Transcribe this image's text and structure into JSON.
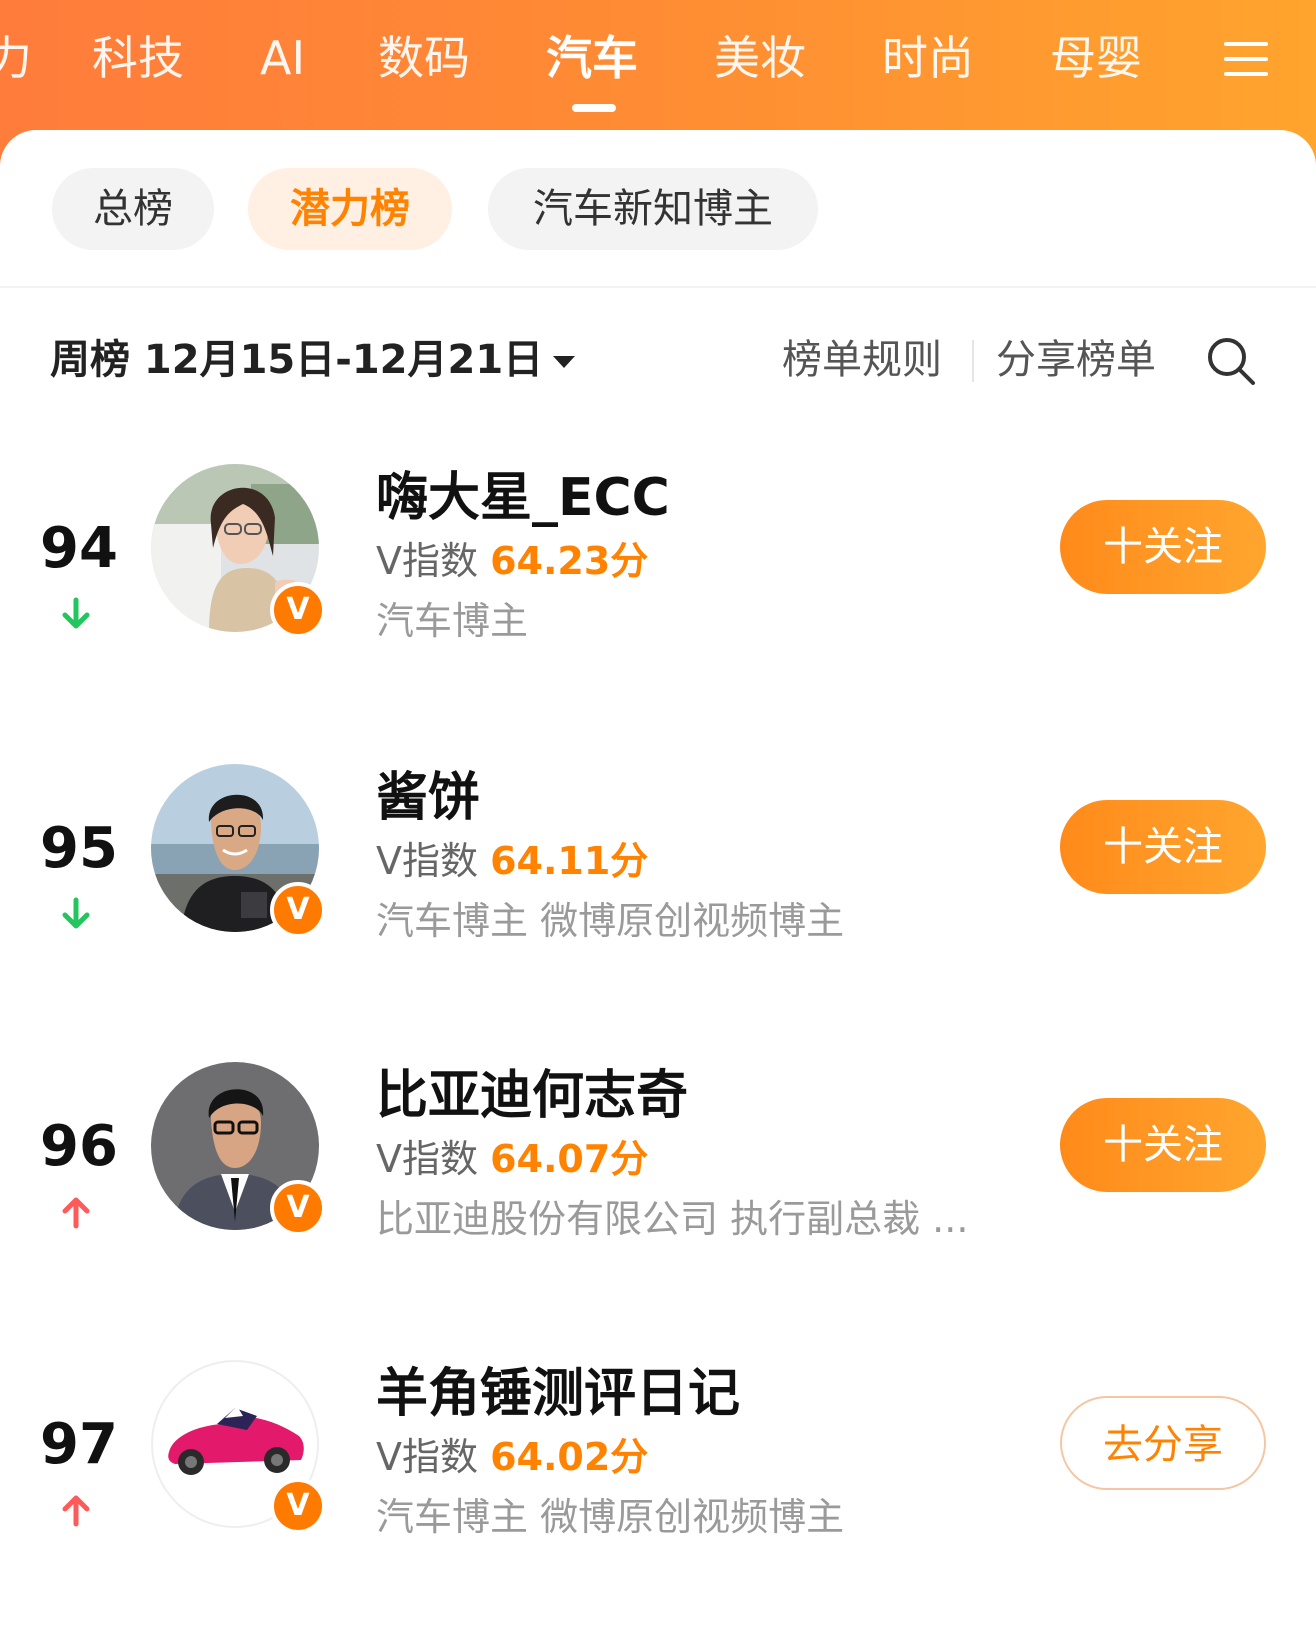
{
  "categories": {
    "items": [
      "力",
      "科技",
      "AI",
      "数码",
      "汽车",
      "美妆",
      "时尚",
      "母婴"
    ],
    "active": "汽车"
  },
  "chips": [
    "总榜",
    "潜力榜",
    "汽车新知博主"
  ],
  "period": "周榜 12月15日-12月21日",
  "links": {
    "rules": "榜单规则",
    "share": "分享榜单"
  },
  "v_label": "V指数",
  "v_badge": "V",
  "rows": [
    {
      "rank": "94",
      "trend": "down",
      "name": "嗨大星_ECC",
      "score": "64.23分",
      "tags": "汽车博主",
      "button": "十关注"
    },
    {
      "rank": "95",
      "trend": "down",
      "name": "酱饼",
      "score": "64.11分",
      "tags": "汽车博主 微博原创视频博主",
      "button": "十关注"
    },
    {
      "rank": "96",
      "trend": "up",
      "name": "比亚迪何志奇",
      "score": "64.07分",
      "tags": "比亚迪股份有限公司 执行副总裁 ...",
      "button": "十关注"
    },
    {
      "rank": "97",
      "trend": "up",
      "name": "羊角锤测评日记",
      "score": "64.02分",
      "tags": "汽车博主 微博原创视频博主",
      "button": "去分享"
    }
  ],
  "colors": {
    "accent": "#ff8200",
    "trend_down": "#22c55e",
    "trend_up": "#ff5a5a",
    "header_start": "#ff7c3b",
    "header_end": "#ffa42d"
  }
}
